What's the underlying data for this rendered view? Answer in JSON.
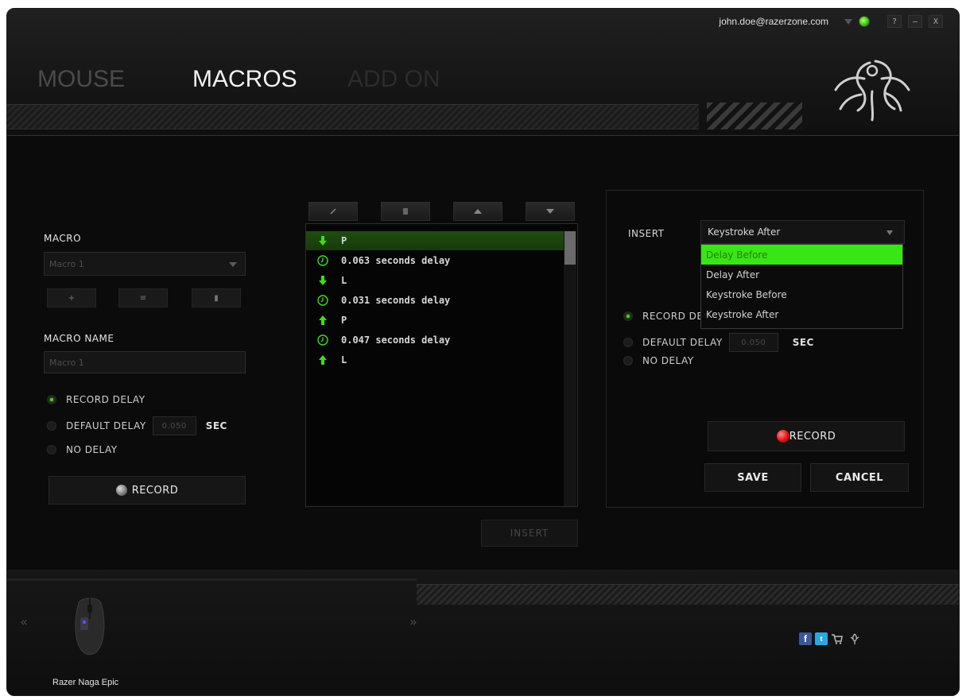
{
  "header": {
    "email": "john.doe@razerzone.com",
    "window_buttons": [
      "?",
      "–",
      "X"
    ],
    "tabs": [
      {
        "label": "MOUSE"
      },
      {
        "label": "MACROS"
      },
      {
        "label": "ADD ON"
      }
    ]
  },
  "left_panel": {
    "macro_label": "MACRO",
    "macro_select_value": "Macro 1",
    "macro_buttons": [
      "+",
      "≡",
      "▮"
    ],
    "macro_name_label": "MACRO NAME",
    "macro_name_value": "Macro 1",
    "delay_options": {
      "record_delay": "RECORD DELAY",
      "default_delay": "DEFAULT DELAY",
      "no_delay": "NO DELAY",
      "default_value": "0.050",
      "unit": "SEC"
    },
    "record_label": "RECORD"
  },
  "macro_list": {
    "rows": [
      {
        "icon": "arrow-down-icon",
        "text": "P"
      },
      {
        "icon": "clock-icon",
        "text": "0.063 seconds delay"
      },
      {
        "icon": "arrow-down-icon",
        "text": "L"
      },
      {
        "icon": "clock-icon",
        "text": "0.031 seconds delay"
      },
      {
        "icon": "arrow-up-icon",
        "text": "P"
      },
      {
        "icon": "clock-icon",
        "text": "0.047 seconds delay"
      },
      {
        "icon": "arrow-up-icon",
        "text": "L"
      }
    ],
    "insert_label": "INSERT"
  },
  "right_panel": {
    "insert_label": "INSERT",
    "insert_select_value": "Keystroke After",
    "dropdown_options": [
      "Delay Before",
      "Delay After",
      "Keystroke Before",
      "Keystroke After"
    ],
    "record_delay": "RECORD DELAY",
    "default_delay": "DEFAULT DELAY",
    "no_delay": "NO DELAY",
    "default_value": "0.050",
    "unit": "SEC",
    "record_label": "RECORD",
    "save_label": "SAVE",
    "cancel_label": "CANCEL"
  },
  "footer": {
    "device_name": "Razer Naga Epic",
    "prev": "«",
    "next": "»"
  },
  "colors": {
    "accent": "#44dd11",
    "highlight": "#39e615",
    "record_red": "#e01010"
  }
}
